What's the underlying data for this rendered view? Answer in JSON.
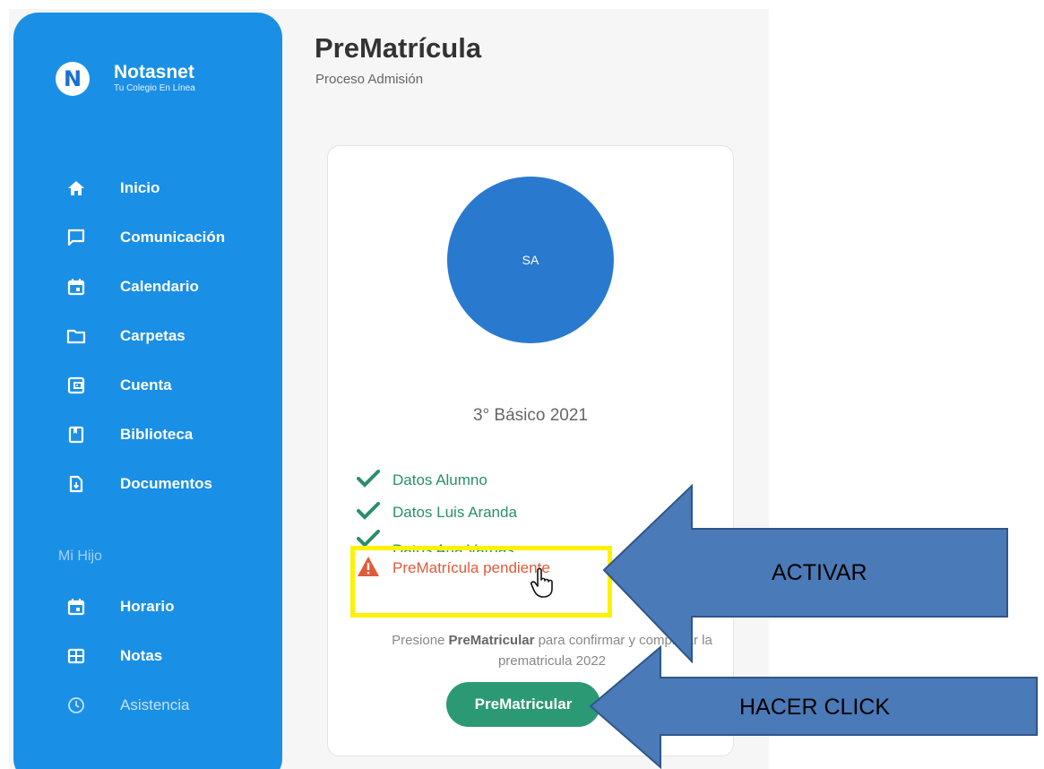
{
  "brand": {
    "logo_letter": "N",
    "name": "Notasnet",
    "tagline": "Tu Colegio En Línea"
  },
  "nav": [
    {
      "label": "Inicio",
      "icon": "home-icon"
    },
    {
      "label": "Comunicación",
      "icon": "chat-icon"
    },
    {
      "label": "Calendario",
      "icon": "calendar-icon"
    },
    {
      "label": "Carpetas",
      "icon": "folder-icon"
    },
    {
      "label": "Cuenta",
      "icon": "wallet-icon"
    },
    {
      "label": "Biblioteca",
      "icon": "book-icon"
    },
    {
      "label": "Documentos",
      "icon": "document-icon"
    }
  ],
  "section_label": "Mi Hijo",
  "nav2": [
    {
      "label": "Horario",
      "icon": "calendar-icon"
    },
    {
      "label": "Notas",
      "icon": "grid-icon"
    },
    {
      "label": "Asistencia",
      "icon": "clock-icon"
    }
  ],
  "page": {
    "title": "PreMatrícula",
    "subtitle": "Proceso Admisión"
  },
  "card": {
    "avatar_initials": "SA",
    "grade": "3° Básico 2021",
    "checks": [
      "Datos Alumno",
      "Datos Luis Aranda",
      "Datos Ana Vargas"
    ],
    "pending": "PreMatrícula pendiente",
    "hint_pre": "Presione ",
    "hint_bold": "PreMatricular",
    "hint_post": " para confirmar y completar la prematricula 2022",
    "button": "PreMatricular"
  },
  "annotations": {
    "activate": "ACTIVAR",
    "click": "HACER CLICK"
  },
  "colors": {
    "sidebar": "#1a8fe6",
    "avatar": "#2979cf",
    "success": "#2a8f67",
    "warning": "#e05a3a",
    "button": "#2b9a74",
    "arrow": "#4a7ab8",
    "highlight": "#fdf200"
  }
}
